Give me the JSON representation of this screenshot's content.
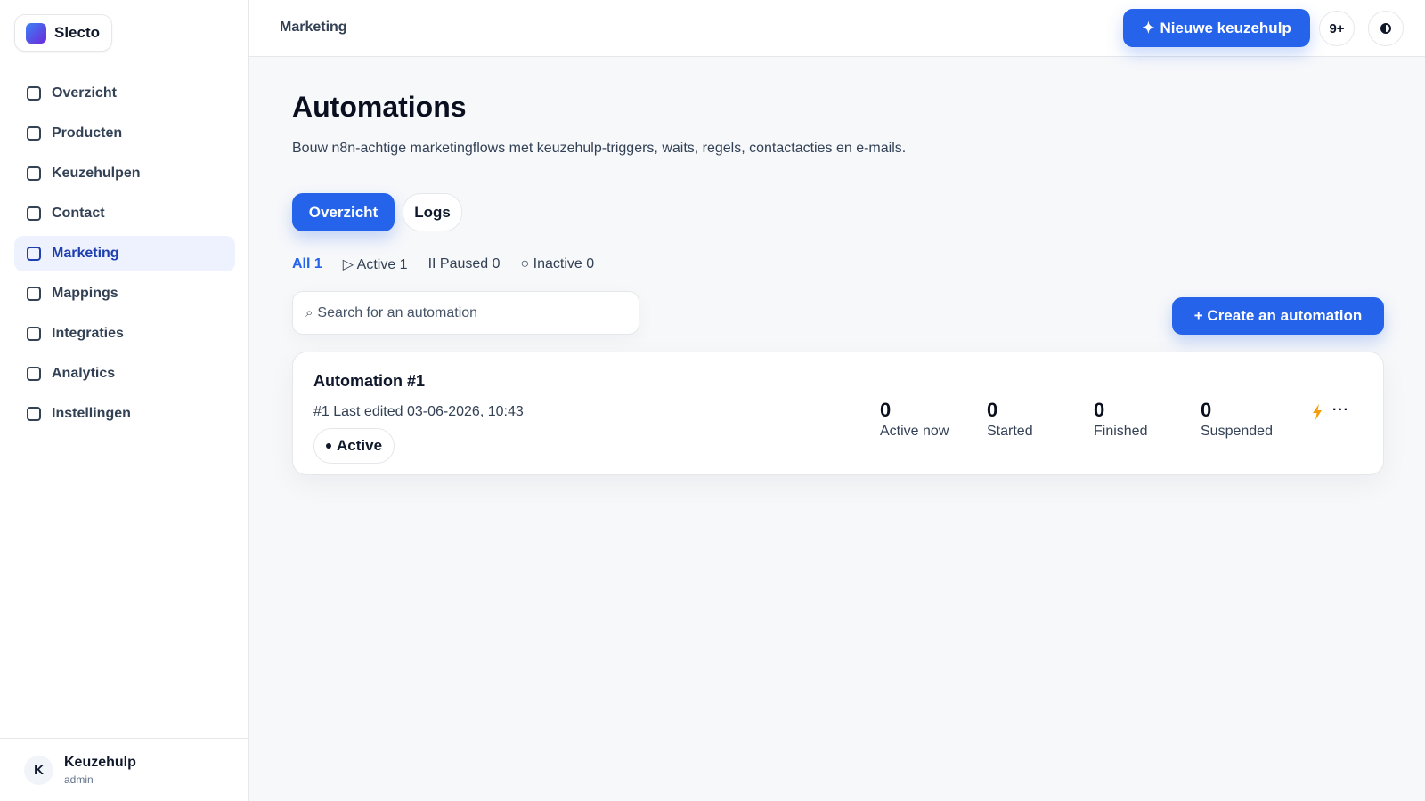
{
  "brand": {
    "name": "Slecto"
  },
  "sidebar": {
    "items": [
      {
        "label": "Overzicht"
      },
      {
        "label": "Producten"
      },
      {
        "label": "Keuzehulpen"
      },
      {
        "label": "Contact"
      },
      {
        "label": "Marketing",
        "active": true
      },
      {
        "label": "Mappings"
      },
      {
        "label": "Integraties"
      },
      {
        "label": "Analytics"
      },
      {
        "label": "Instellingen"
      }
    ],
    "user": {
      "initial": "K",
      "name": "Keuzehulp",
      "role": "admin"
    }
  },
  "header": {
    "breadcrumb": "Marketing",
    "new_button": {
      "icon": "✦",
      "label": "Nieuwe keuzehulp"
    },
    "notifications": "9+",
    "theme_icon": "contrast-icon"
  },
  "main": {
    "title": "Automations",
    "description": "Bouw n8n-achtige marketingflows met keuzehulp-triggers, waits, regels, contactacties en e-mails.",
    "tabs": [
      {
        "label": "Overzicht",
        "active": true
      },
      {
        "label": "Logs"
      }
    ],
    "filters": [
      {
        "label": "All 1",
        "current": true
      },
      {
        "label": "▷ Active 1"
      },
      {
        "label": "II Paused 0"
      },
      {
        "label": "○ Inactive 0"
      }
    ],
    "search": {
      "icon": "⌕",
      "placeholder": "Search for an automation"
    },
    "create_button": "+ Create an automation",
    "automations": [
      {
        "title": "Automation #1",
        "meta": "#1 Last edited 03-06-2026, 10:43",
        "status": "Active",
        "stats": [
          {
            "value": "0",
            "label": "Active now"
          },
          {
            "value": "0",
            "label": "Started"
          },
          {
            "value": "0",
            "label": "Finished"
          },
          {
            "value": "0",
            "label": "Suspended"
          }
        ],
        "more": "···"
      }
    ]
  },
  "colors": {
    "accent": "#2563eb",
    "bolt": "#f59e0b",
    "active_nav_bg": "#eef2ff",
    "active_nav_text": "#1e40af"
  }
}
